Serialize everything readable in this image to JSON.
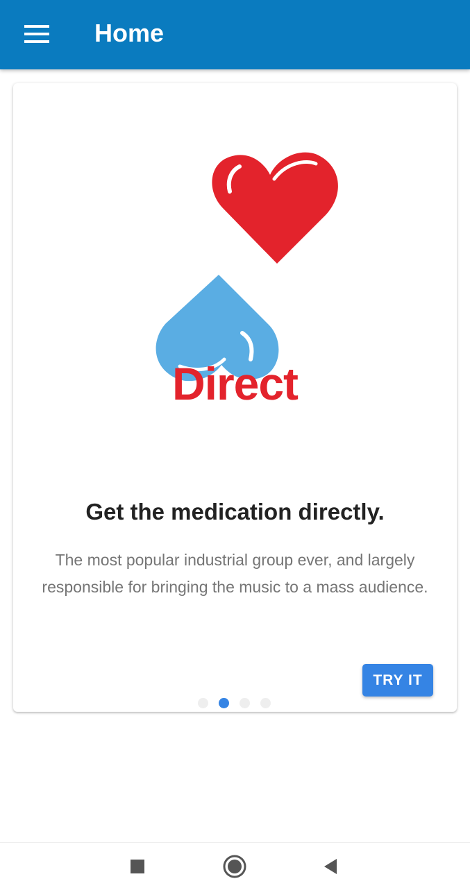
{
  "app_bar": {
    "title": "Home",
    "menu_icon": "hamburger-menu-icon",
    "background": "#0a7bbf"
  },
  "onboarding": {
    "logo": {
      "word": "Direct",
      "heart_color": "#e3232c",
      "drop_color": "#5aade3"
    },
    "slide_title": "Get the medication directly.",
    "slide_text": "The most popular industrial group ever, and largely responsible for bringing the music to a mass audience.",
    "try_button": "TRY IT",
    "accent": "#3584e4",
    "pager": {
      "total": 4,
      "active": 2
    }
  },
  "system_nav": {
    "icons": [
      "recent-apps-icon",
      "home-icon",
      "back-icon"
    ]
  }
}
